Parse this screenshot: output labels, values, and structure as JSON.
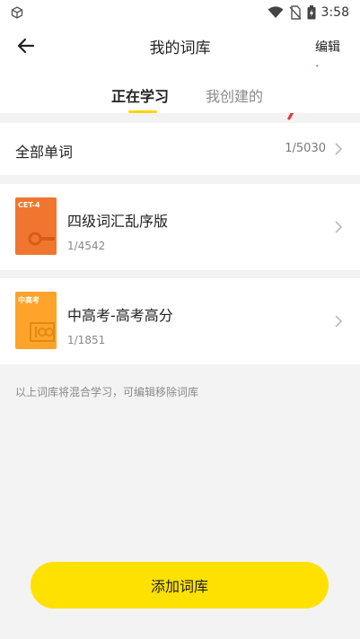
{
  "status": {
    "time": "3:58"
  },
  "header": {
    "title": "我的词库",
    "edit_label": "编辑"
  },
  "tabs": [
    {
      "label": "正在学习",
      "active": true
    },
    {
      "label": "我创建的",
      "active": false
    }
  ],
  "all_words": {
    "label": "全部单词",
    "count": "1/5030"
  },
  "books": [
    {
      "cover_text": "CET-4",
      "cover_color": "#f0762f",
      "title": "四级词汇乱序版",
      "progress": "1/4542"
    },
    {
      "cover_text": "中高考",
      "cover_color": "#ffa32a",
      "title": "中高考-高考高分",
      "progress": "1/1851"
    }
  ],
  "hint": "以上词库将混合学习，可编辑移除词库",
  "add_button": {
    "label": "添加词库"
  },
  "colors": {
    "accent": "#ffe100",
    "annotation": "#e53935"
  }
}
